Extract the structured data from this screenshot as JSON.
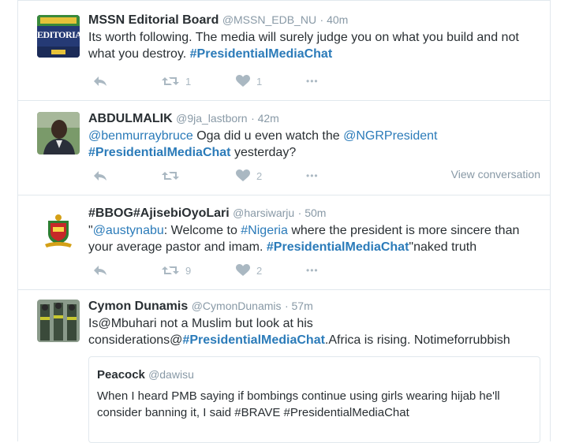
{
  "tweets": [
    {
      "fullname": "MSSN Editorial Board",
      "username": "@MSSN_EDB_NU",
      "time": "· 40m",
      "text_plain": "Its worth following. The media will surely judge you on what you build and not what you destroy. ",
      "hashtag": "#PresidentialMediaChat",
      "retweets": "1",
      "likes": "1",
      "avatar_label": "EDITORIA"
    },
    {
      "fullname": "ABDULMALIK",
      "username": "@9ja_lastborn",
      "time": "· 42m",
      "mention1": "@benmurraybruce",
      "text_mid": " Oga did u even watch the ",
      "mention2": "@NGRPresident",
      "hashtag": "#PresidentialMediaChat",
      "text_end": " yesterday?",
      "retweets": "",
      "likes": "2",
      "view_conversation": "View conversation"
    },
    {
      "fullname": "#BBOG#AjisebiOyoLari",
      "username": "@harsiwarju",
      "time": "· 50m",
      "quote_open": "\"",
      "mention1": "@austynabu",
      "text_mid": ": Welcome to ",
      "hashtag1": "#Nigeria",
      "text_mid2": " where the president is more sincere than your average pastor and imam. ",
      "hashtag2": "#PresidentialMediaChat",
      "text_end": "\"naked truth",
      "retweets": "9",
      "likes": "2"
    },
    {
      "fullname": "Cymon Dunamis",
      "username": "@CymonDunamis",
      "time": "· 57m",
      "text_start": "Is@Mbuhari not a Muslim but look at his considerations@",
      "hashtag": "#PresidentialMediaChat",
      "text_end": ".Africa is rising. Notimeforrubbish",
      "quote_name": "Peacock",
      "quote_user": "@dawisu",
      "quote_text": "When I heard PMB saying if bombings continue using girls wearing hijab he'll consider banning it, I said #BRAVE #PresidentialMediaChat"
    }
  ],
  "actions": {
    "more": "•••"
  },
  "colors": {
    "link": "#2b7bb9",
    "muted": "#8899a6",
    "icon": "#aab8c2",
    "border": "#e1e8ed"
  }
}
